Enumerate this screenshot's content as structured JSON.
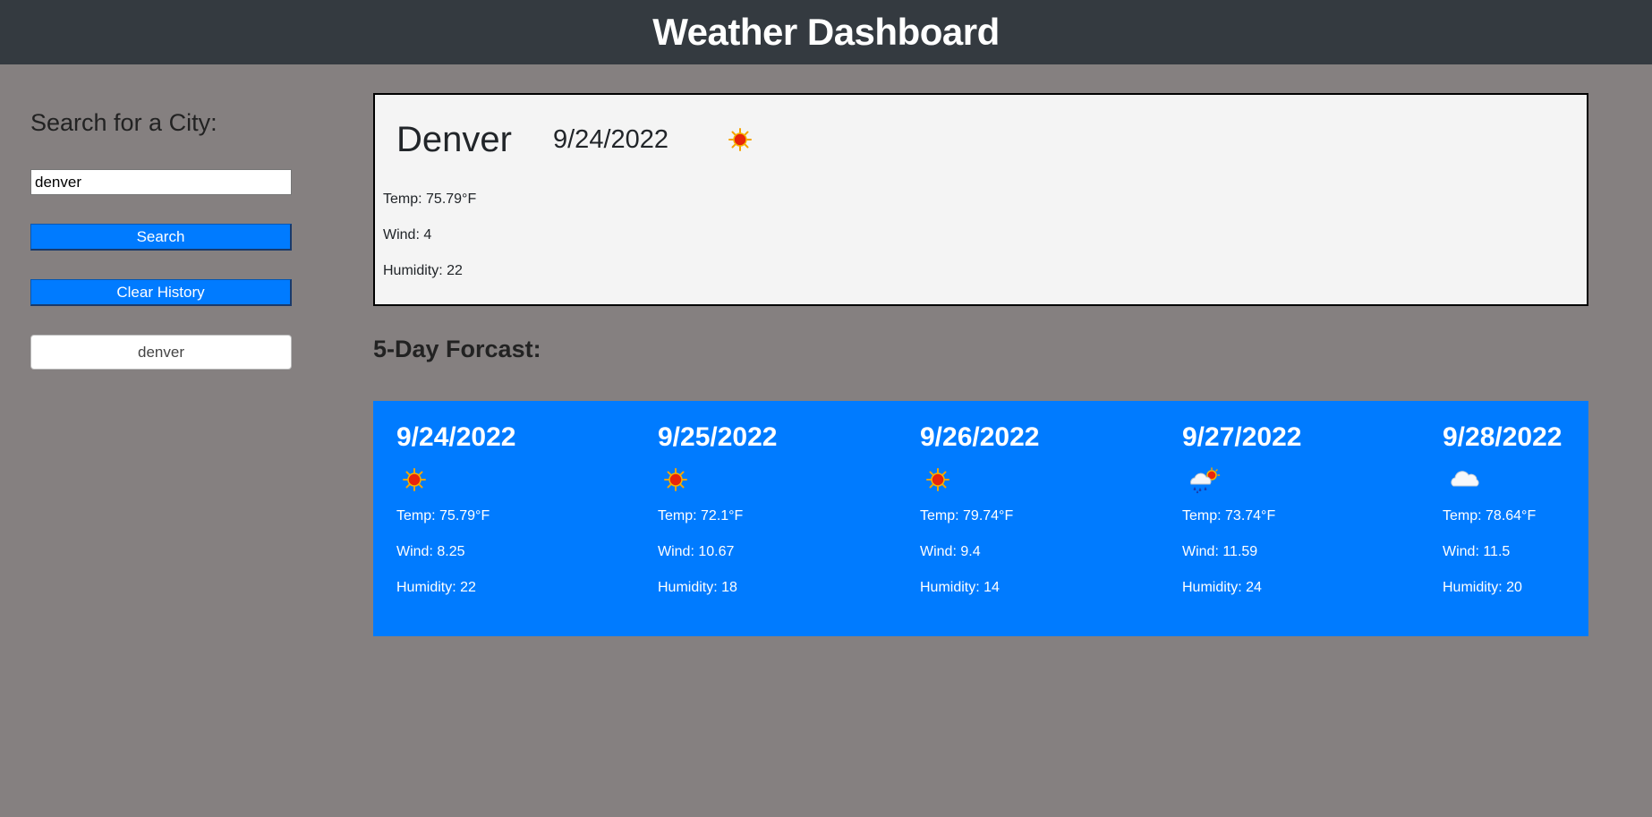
{
  "header": {
    "title": "Weather Dashboard"
  },
  "sidebar": {
    "heading": "Search for a City:",
    "search_value": "denver",
    "search_label": "Search",
    "clear_label": "Clear History",
    "history": [
      "denver"
    ]
  },
  "current": {
    "city": "Denver",
    "date": "9/24/2022",
    "icon": "sun-icon",
    "temp": "Temp: 75.79°F",
    "wind": "Wind: 4",
    "humidity": "Humidity: 22"
  },
  "forecast": {
    "heading": "5-Day Forcast:",
    "days": [
      {
        "date": "9/24/2022",
        "icon": "sun-icon",
        "temp": "Temp: 75.79°F",
        "wind": "Wind: 8.25",
        "humidity": "Humidity: 22"
      },
      {
        "date": "9/25/2022",
        "icon": "sun-icon",
        "temp": "Temp: 72.1°F",
        "wind": "Wind: 10.67",
        "humidity": "Humidity: 18"
      },
      {
        "date": "9/26/2022",
        "icon": "sun-icon",
        "temp": "Temp: 79.74°F",
        "wind": "Wind: 9.4",
        "humidity": "Humidity: 14"
      },
      {
        "date": "9/27/2022",
        "icon": "rain-sun-icon",
        "temp": "Temp: 73.74°F",
        "wind": "Wind: 11.59",
        "humidity": "Humidity: 24"
      },
      {
        "date": "9/28/2022",
        "icon": "cloud-icon",
        "temp": "Temp: 78.64°F",
        "wind": "Wind: 11.5",
        "humidity": "Humidity: 20"
      }
    ]
  },
  "colors": {
    "header_bg": "#343a40",
    "page_bg": "#858080",
    "accent": "#007bff",
    "card_bg": "#f4f4f4"
  }
}
